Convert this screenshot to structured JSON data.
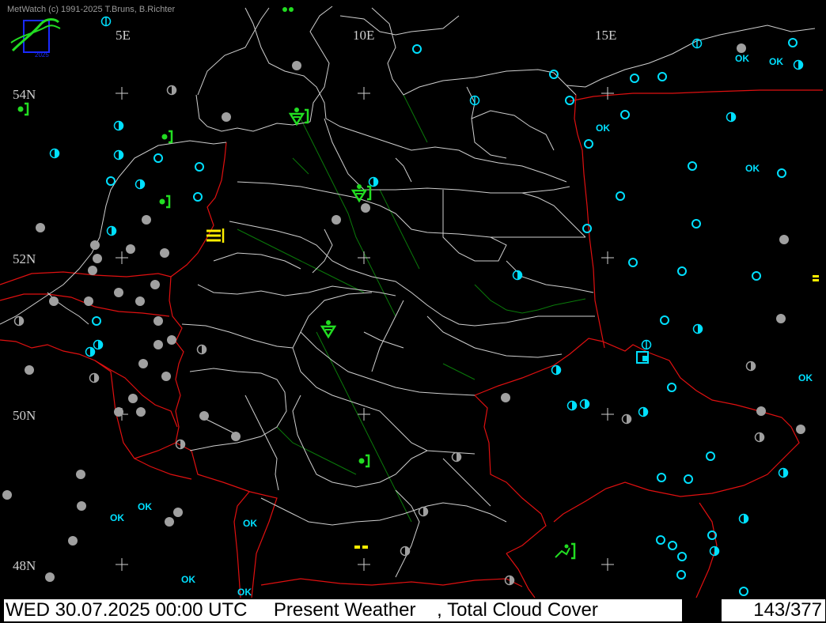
{
  "credit": "MetWatch  (c) 1991-2025 T.Bruns, B.Richter",
  "logo": {
    "icon": "metwatch-logo-icon",
    "text": "2025"
  },
  "grid_labels": {
    "lon": [
      "5E",
      "10E",
      "15E"
    ],
    "lat": [
      "54N",
      "52N",
      "50N",
      "48N"
    ]
  },
  "status": {
    "datetime": "WED 30.07.2025 00:00 UTC",
    "product": "Present Weather",
    "secondary": ", Total Cloud Cover",
    "station_count": "143/377"
  },
  "legend_symbols": {
    "ok_label": "OK",
    "clear_sky": "circle-empty-icon",
    "half_cover": "circle-half-icon",
    "overcast": "circle-filled-grey-icon",
    "rain_recent": "rain-shower-recent-icon",
    "drizzle_recent": "drizzle-recent-icon",
    "fog": "fog-icon",
    "thunder_recent": "thunderstorm-recent-icon"
  },
  "colors": {
    "station_cyan": "#00e0ff",
    "station_grey": "#a0a0a0",
    "weather_green": "#22dd22",
    "weather_yellow": "#ffee00",
    "border_red": "#e01010",
    "admin_white": "#d8d8d8",
    "river_green": "#0a8a0a"
  }
}
